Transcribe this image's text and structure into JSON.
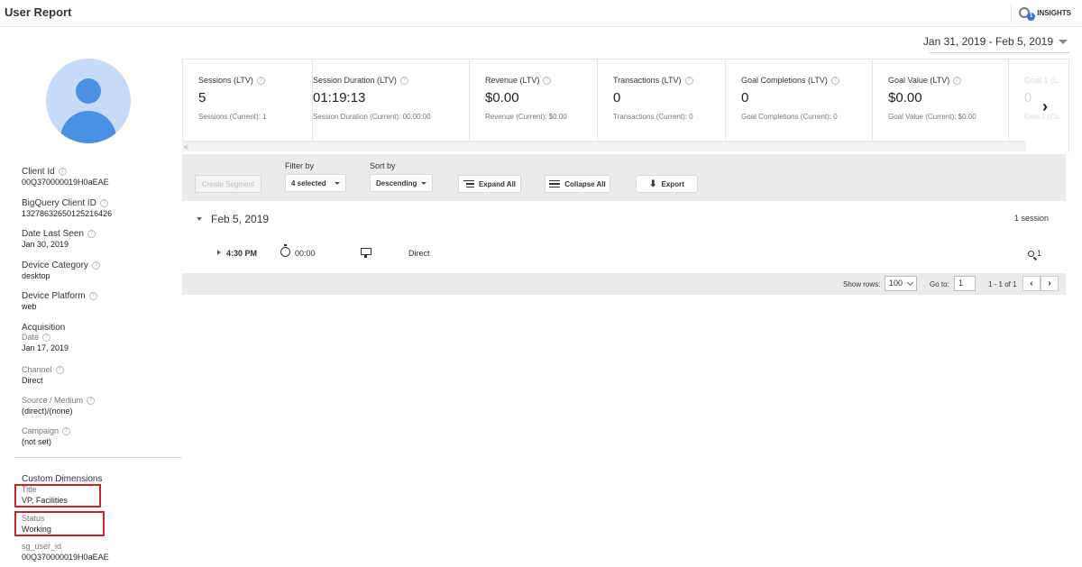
{
  "header": {
    "title": "User Report",
    "insights_label": "INSIGHTS",
    "insights_badge": "1",
    "date_range": "Jan 31, 2019 - Feb 5, 2019"
  },
  "sidebar": {
    "client_id_label": "Client Id",
    "client_id": "00Q370000019H0aEAE",
    "bq_client_id_label": "BigQuery Client ID",
    "bq_client_id": "13278632650125216426",
    "last_seen_label": "Date Last Seen",
    "last_seen": "Jan 30, 2019",
    "device_category_label": "Device Category",
    "device_category": "desktop",
    "device_platform_label": "Device Platform",
    "device_platform": "web",
    "acquisition_label": "Acquisition",
    "acq_date_label": "Date",
    "acq_date": "Jan 17, 2019",
    "channel_label": "Channel",
    "channel": "Direct",
    "source_medium_label": "Source / Medium",
    "source_medium": "(direct)/(none)",
    "campaign_label": "Campaign",
    "campaign": "(not set)",
    "custom_dimensions_label": "Custom Dimensions",
    "title_label": "Title",
    "title_value": "VP, Facilities",
    "status_label": "Status",
    "status_value": "Working",
    "sg_user_id_label": "sg_user_id",
    "sg_user_id": "00Q370000019H0aEAE"
  },
  "metrics": [
    {
      "label": "Sessions (LTV)",
      "value": "5",
      "sub": "Sessions (Current): 1"
    },
    {
      "label": "Session Duration (LTV)",
      "value": "01:19:13",
      "sub": "Session Duration (Current): 00:00:00"
    },
    {
      "label": "Revenue (LTV)",
      "value": "$0.00",
      "sub": "Revenue (Current): $0.00"
    },
    {
      "label": "Transactions (LTV)",
      "value": "0",
      "sub": "Transactions (Current): 0"
    },
    {
      "label": "Goal Completions (LTV)",
      "value": "0",
      "sub": "Goal Completions (Current): 0"
    },
    {
      "label": "Goal Value (LTV)",
      "value": "$0.00",
      "sub": "Goal Value (Current): $0.00"
    },
    {
      "label": "Goal 1 (L",
      "value": "0",
      "sub": "Goal 1 (Cu"
    }
  ],
  "toolbar": {
    "create_segment": "Create Segment",
    "filter_label": "Filter by",
    "filter_value": "4 selected",
    "sort_label": "Sort by",
    "sort_value": "Descending",
    "expand_all": "Expand All",
    "collapse_all": "Collapse All",
    "export": "Export"
  },
  "sessions": {
    "date": "Feb 5, 2019",
    "count": "1 session",
    "row": {
      "time": "4:30 PM",
      "duration": "00:00",
      "channel": "Direct",
      "goals": "1"
    }
  },
  "pager": {
    "show_rows_label": "Show rows:",
    "show_rows_value": "100",
    "goto_label": "Go to:",
    "goto_value": "1",
    "range": "1 - 1 of 1"
  }
}
